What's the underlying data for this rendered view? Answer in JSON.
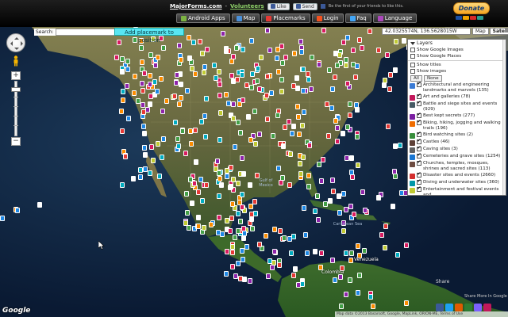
{
  "header": {
    "site_link": "MajorForms.com",
    "separator": "-",
    "volunteers_link": "Volunteers",
    "like_label": "Like",
    "send_label": "Send",
    "fb_text": "Be the first of your friends to like this.",
    "donate_label": "Donate",
    "card_colors": [
      "#1a4fa3",
      "#f0a500",
      "#d62828",
      "#2a9d8f"
    ]
  },
  "nav": [
    {
      "label": "Android Apps",
      "icon_color": "#7cb342",
      "icon": "android-icon"
    },
    {
      "label": "Map",
      "icon_color": "#4a90d9",
      "icon": "map-icon"
    },
    {
      "label": "Placemarks",
      "icon_color": "#e53935",
      "icon": "placemark-icon"
    },
    {
      "label": "Login",
      "icon_color": "#f4511e",
      "icon": "login-icon"
    },
    {
      "label": "Faq",
      "icon_color": "#42a5f5",
      "icon": "faq-icon"
    },
    {
      "label": "Language",
      "icon_color": "#ab47bc",
      "icon": "language-icon"
    }
  ],
  "search": {
    "label": "Search:",
    "value": ""
  },
  "add_placemark_label": "Add placemark to position",
  "coordinates": "42.0325574N, 136.5628015W",
  "map_types": [
    "Map",
    "Satellite"
  ],
  "layers": {
    "title": "Layers",
    "options": [
      {
        "label": "Show Google Images",
        "checked": false
      },
      {
        "label": "Show Google Places",
        "checked": false
      },
      {
        "label": "Show titles",
        "checked": false
      },
      {
        "label": "Show images",
        "checked": false
      }
    ],
    "all_label": "All",
    "none_label": "None",
    "categories": [
      {
        "label": "Architectural and engineering landmarks and marvels (135)",
        "color": "#3a7bd5",
        "checked": true
      },
      {
        "label": "Art and galleries (78)",
        "color": "#c2185b",
        "checked": true
      },
      {
        "label": "Battle and siege sites and events (929)",
        "color": "#455a64",
        "checked": true
      },
      {
        "label": "Best kept secrets (277)",
        "color": "#7b1fa2",
        "checked": true
      },
      {
        "label": "Biking, hiking, jogging and walking trails (196)",
        "color": "#ef6c00",
        "checked": true
      },
      {
        "label": "Bird watching sites (2)",
        "color": "#388e3c",
        "checked": true
      },
      {
        "label": "Castles (46)",
        "color": "#5d4037",
        "checked": true
      },
      {
        "label": "Caving sites (3)",
        "color": "#616161",
        "checked": true
      },
      {
        "label": "Cemeteries and grave sites (1254)",
        "color": "#1976d2",
        "checked": true
      },
      {
        "label": "Churches, temples, mosques, shrines and sacred sites (113)",
        "color": "#6d4c41",
        "checked": true
      },
      {
        "label": "Disaster sites and events (2660)",
        "color": "#d32f2f",
        "checked": true
      },
      {
        "label": "Diving and underwater sites (360)",
        "color": "#0097a7",
        "checked": true
      },
      {
        "label": "Entertainment and festival events and",
        "color": "#c0ca33",
        "checked": true
      }
    ]
  },
  "map_labels": {
    "gulf_mexico": "Gulf of Mexico",
    "caribbean": "Caribbean Sea",
    "venezuela": "Venezuela",
    "colombia": "Colombia"
  },
  "share": {
    "title": "Share",
    "more": "Share More In Google",
    "icon_colors": [
      "#3b5998",
      "#1da1f2",
      "#e05a00",
      "#2e7d32",
      "#7b61ff",
      "#c2185b"
    ]
  },
  "google_logo": "Google",
  "map_data": "Map data ©2013 Basarsoft, Google, MapLink, ORION-ME, Terms of Use",
  "colors": {
    "accent": "#58e6f2",
    "land": "#6f6a3a",
    "ocean": "#0a1a33"
  }
}
